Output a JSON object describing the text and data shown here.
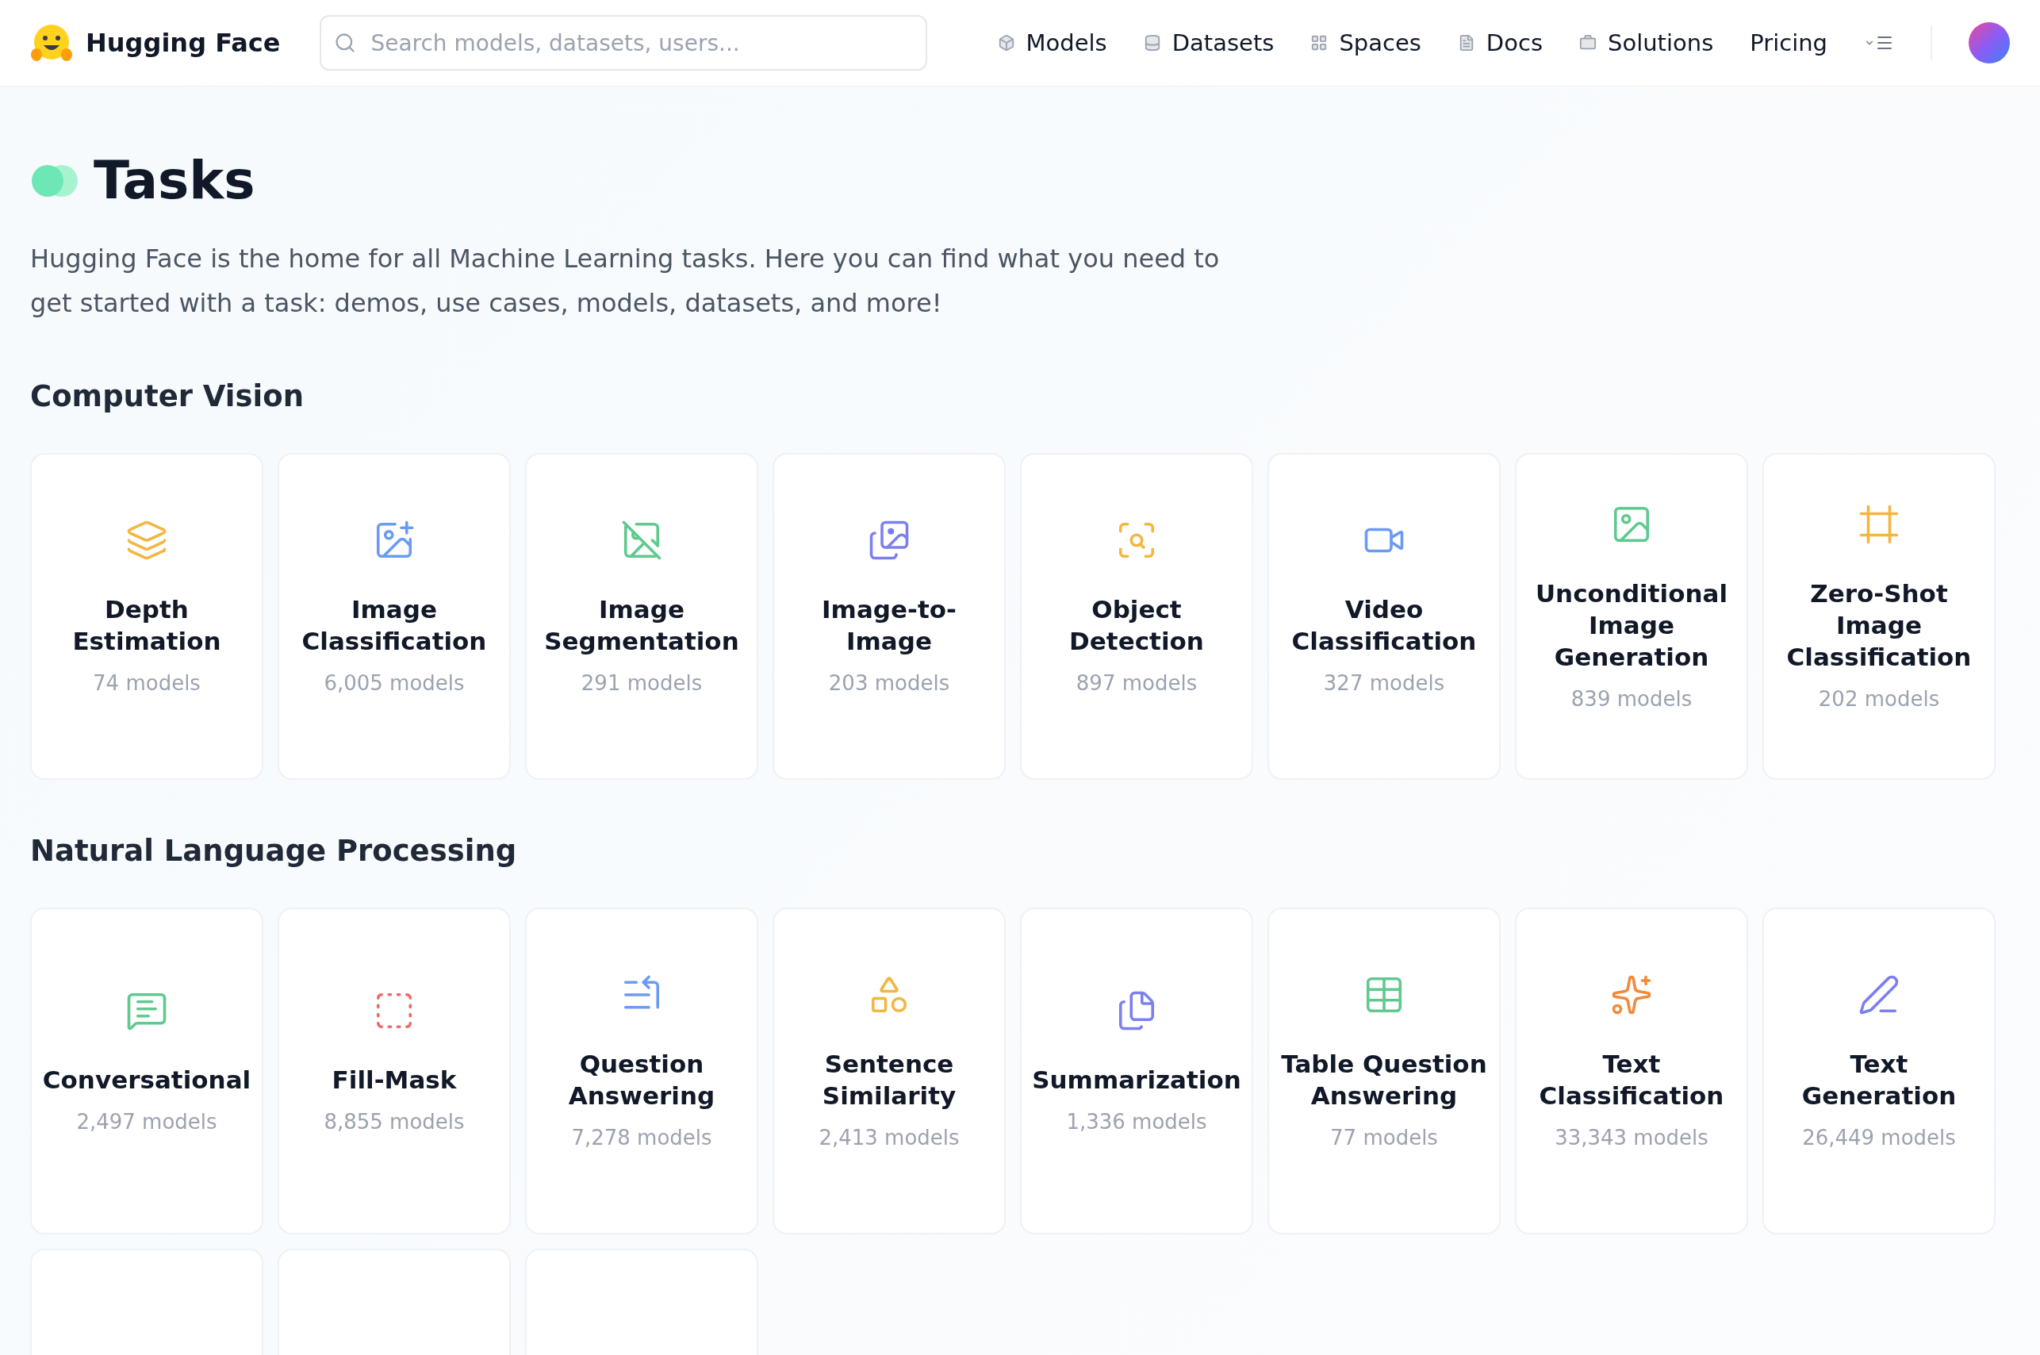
{
  "header": {
    "brand": "Hugging Face",
    "search": {
      "placeholder": "Search models, datasets, users..."
    },
    "nav": [
      {
        "label": "Models"
      },
      {
        "label": "Datasets"
      },
      {
        "label": "Spaces"
      },
      {
        "label": "Docs"
      },
      {
        "label": "Solutions"
      },
      {
        "label": "Pricing"
      }
    ]
  },
  "page": {
    "title": "Tasks",
    "description": "Hugging Face is the home for all Machine Learning tasks. Here you can find what you need to get started with a task: demos, use cases, models, datasets, and more!"
  },
  "sections": [
    {
      "title": "Computer Vision",
      "tasks": [
        {
          "name": "Depth Estimation",
          "count": "74 models",
          "color": "#f4b63f"
        },
        {
          "name": "Image Classification",
          "count": "6,005 models",
          "color": "#6a9bf4"
        },
        {
          "name": "Image Segmentation",
          "count": "291 models",
          "color": "#5fc98e"
        },
        {
          "name": "Image-to-Image",
          "count": "203 models",
          "color": "#7c80ef"
        },
        {
          "name": "Object Detection",
          "count": "897 models",
          "color": "#f4b63f"
        },
        {
          "name": "Video Classification",
          "count": "327 models",
          "color": "#6a9bf4"
        },
        {
          "name": "Unconditional Image Generation",
          "count": "839 models",
          "color": "#5fc98e"
        },
        {
          "name": "Zero-Shot Image Classification",
          "count": "202 models",
          "color": "#f4b63f"
        }
      ]
    },
    {
      "title": "Natural Language Processing",
      "tasks": [
        {
          "name": "Conversational",
          "count": "2,497 models",
          "color": "#5fc98e"
        },
        {
          "name": "Fill-Mask",
          "count": "8,855 models",
          "color": "#ef6868"
        },
        {
          "name": "Question Answering",
          "count": "7,278 models",
          "color": "#6a9bf4"
        },
        {
          "name": "Sentence Similarity",
          "count": "2,413 models",
          "color": "#f4b63f"
        },
        {
          "name": "Summarization",
          "count": "1,336 models",
          "color": "#7c80ef"
        },
        {
          "name": "Table Question Answering",
          "count": "77 models",
          "color": "#5fc98e"
        },
        {
          "name": "Text Classification",
          "count": "33,343 models",
          "color": "#f08a3c"
        },
        {
          "name": "Text Generation",
          "count": "26,449 models",
          "color": "#7c80ef"
        }
      ]
    }
  ]
}
